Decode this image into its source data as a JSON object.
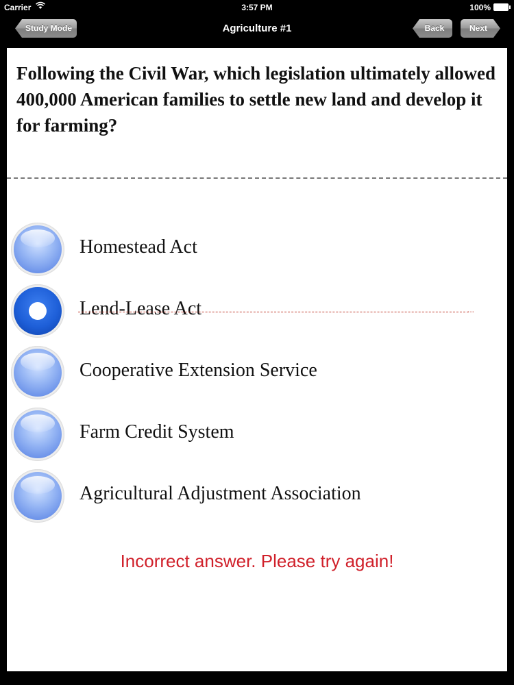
{
  "status_bar": {
    "carrier": "Carrier",
    "time": "3:57 PM",
    "battery": "100%"
  },
  "nav": {
    "title": "Agriculture #1",
    "study_mode_label": "Study Mode",
    "back_label": "Back",
    "next_label": "Next"
  },
  "question": {
    "text": "Following the Civil War, which legislation ultimately allowed 400,000 American families to settle new land and develop it for farming?"
  },
  "options": [
    {
      "label": "Homestead Act",
      "selected": false,
      "struck": false
    },
    {
      "label": "Lend-Lease Act",
      "selected": true,
      "struck": true
    },
    {
      "label": "Cooperative Extension Service",
      "selected": false,
      "struck": false
    },
    {
      "label": "Farm Credit System",
      "selected": false,
      "struck": false
    },
    {
      "label": "Agricultural Adjustment Association",
      "selected": false,
      "struck": false
    }
  ],
  "feedback": {
    "text": "Incorrect answer. Please try again!",
    "color": "#d0202a"
  },
  "icons": {
    "wifi": "wifi-icon",
    "battery": "battery-icon",
    "radio_selected": "radio-selected-icon",
    "radio_unselected": "radio-unselected-icon"
  }
}
